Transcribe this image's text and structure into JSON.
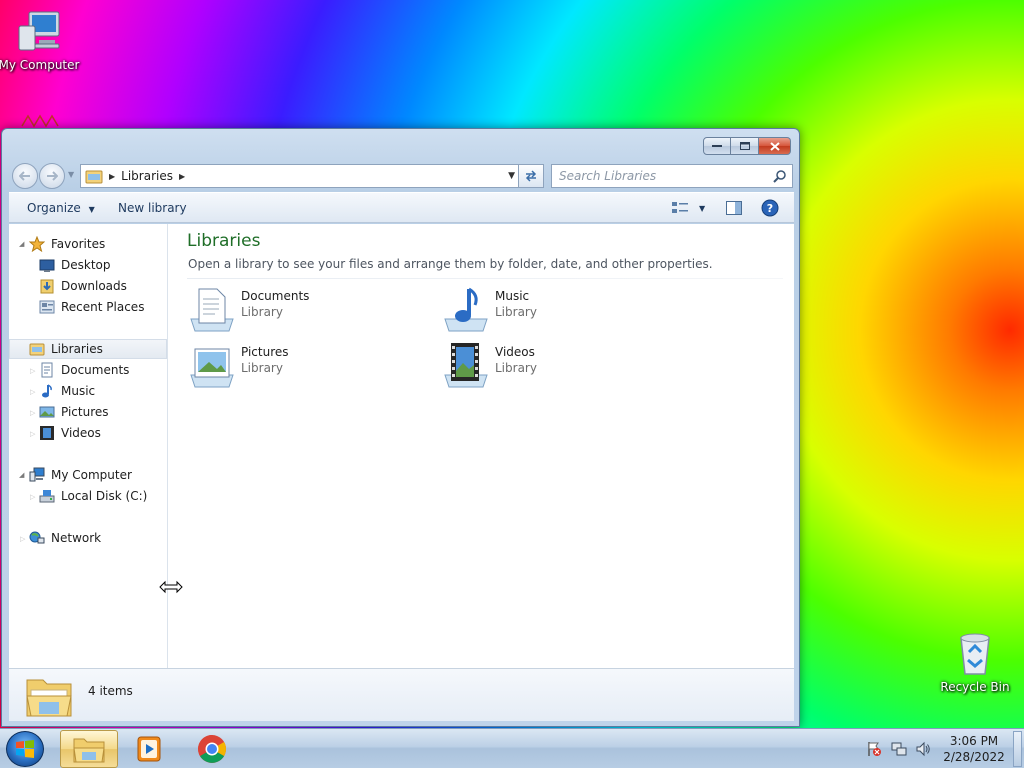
{
  "desktop": {
    "icons": {
      "my_computer": "My Computer",
      "recycle_bin": "Recycle Bin"
    }
  },
  "window": {
    "address": {
      "breadcrumb": "Libraries"
    },
    "search": {
      "placeholder": "Search Libraries"
    },
    "commandbar": {
      "organize": "Organize",
      "new_library": "New library"
    },
    "navpane": {
      "favorites": "Favorites",
      "desktop": "Desktop",
      "downloads": "Downloads",
      "recent_places": "Recent Places",
      "libraries": "Libraries",
      "documents": "Documents",
      "music": "Music",
      "pictures": "Pictures",
      "videos": "Videos",
      "my_computer": "My Computer",
      "local_disk": "Local Disk (C:)",
      "network": "Network"
    },
    "main": {
      "title": "Libraries",
      "description": "Open a library to see your files and arrange them by folder, date, and other properties.",
      "items": [
        {
          "name": "Documents",
          "type": "Library",
          "icon": "documents-library-icon"
        },
        {
          "name": "Music",
          "type": "Library",
          "icon": "music-library-icon"
        },
        {
          "name": "Pictures",
          "type": "Library",
          "icon": "pictures-library-icon"
        },
        {
          "name": "Videos",
          "type": "Library",
          "icon": "videos-library-icon"
        }
      ]
    },
    "details": {
      "count": "4 items"
    }
  },
  "taskbar": {
    "time": "3:06 PM",
    "date": "2/28/2022"
  }
}
